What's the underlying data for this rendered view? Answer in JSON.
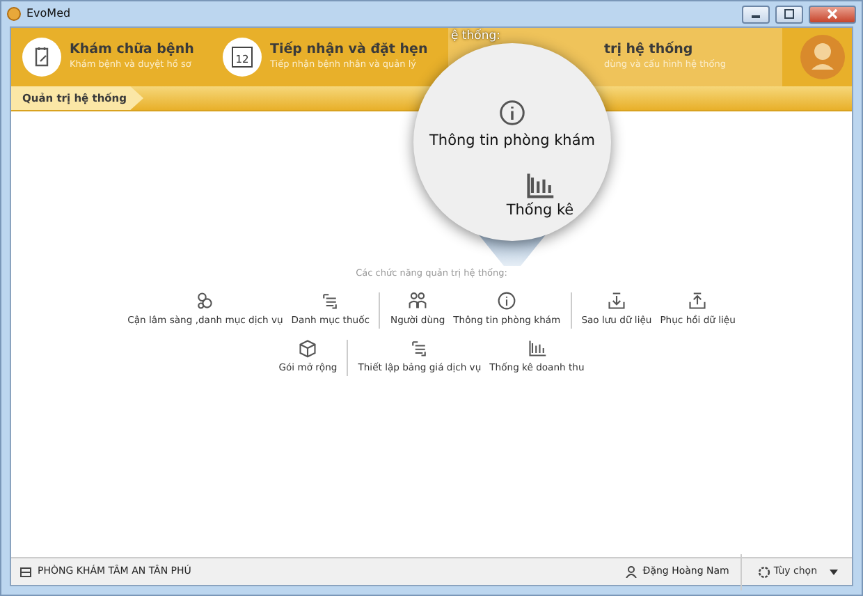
{
  "window": {
    "title": "EvoMed"
  },
  "modules": [
    {
      "title": "Khám chữa bệnh",
      "subtitle": "Khám bệnh và duyệt hồ sơ",
      "selected": false
    },
    {
      "title": "Tiếp nhận và đặt hẹn",
      "subtitle": "Tiếp nhận bệnh nhân và quản lý",
      "day": "12",
      "selected": false
    },
    {
      "title": "trị hệ thống",
      "subtitle": "dùng và cấu hình hệ thống",
      "selected": true
    }
  ],
  "breadcrumb": "Quản trị hệ thống",
  "section_title": "Các chức năng quản trị hệ thống:",
  "tool_rows": [
    [
      [
        {
          "label": "Cận lâm sàng ,danh mục dịch vụ"
        },
        {
          "label": "Danh mục thuốc"
        }
      ],
      [
        {
          "label": "Người dùng"
        },
        {
          "label": "Thông tin phòng khám"
        }
      ],
      [
        {
          "label": "Sao lưu dữ liệu"
        },
        {
          "label": "Phục hồi dữ liệu"
        }
      ]
    ],
    [
      [
        {
          "label": "Gói mở rộng"
        }
      ],
      [
        {
          "label": "Thiết lập bảng giá dịch vụ"
        },
        {
          "label": "Thống kê doanh thu"
        }
      ]
    ]
  ],
  "magnifier": {
    "fragment": "ệ thống:",
    "label": "Thông tin phòng khám",
    "label_2": "Thống kê"
  },
  "status_bar": {
    "clinic": "PHÒNG KHÁM TÂM AN TÂN PHÚ",
    "user": "Đặng Hoàng Nam",
    "options": "Tùy chọn"
  }
}
